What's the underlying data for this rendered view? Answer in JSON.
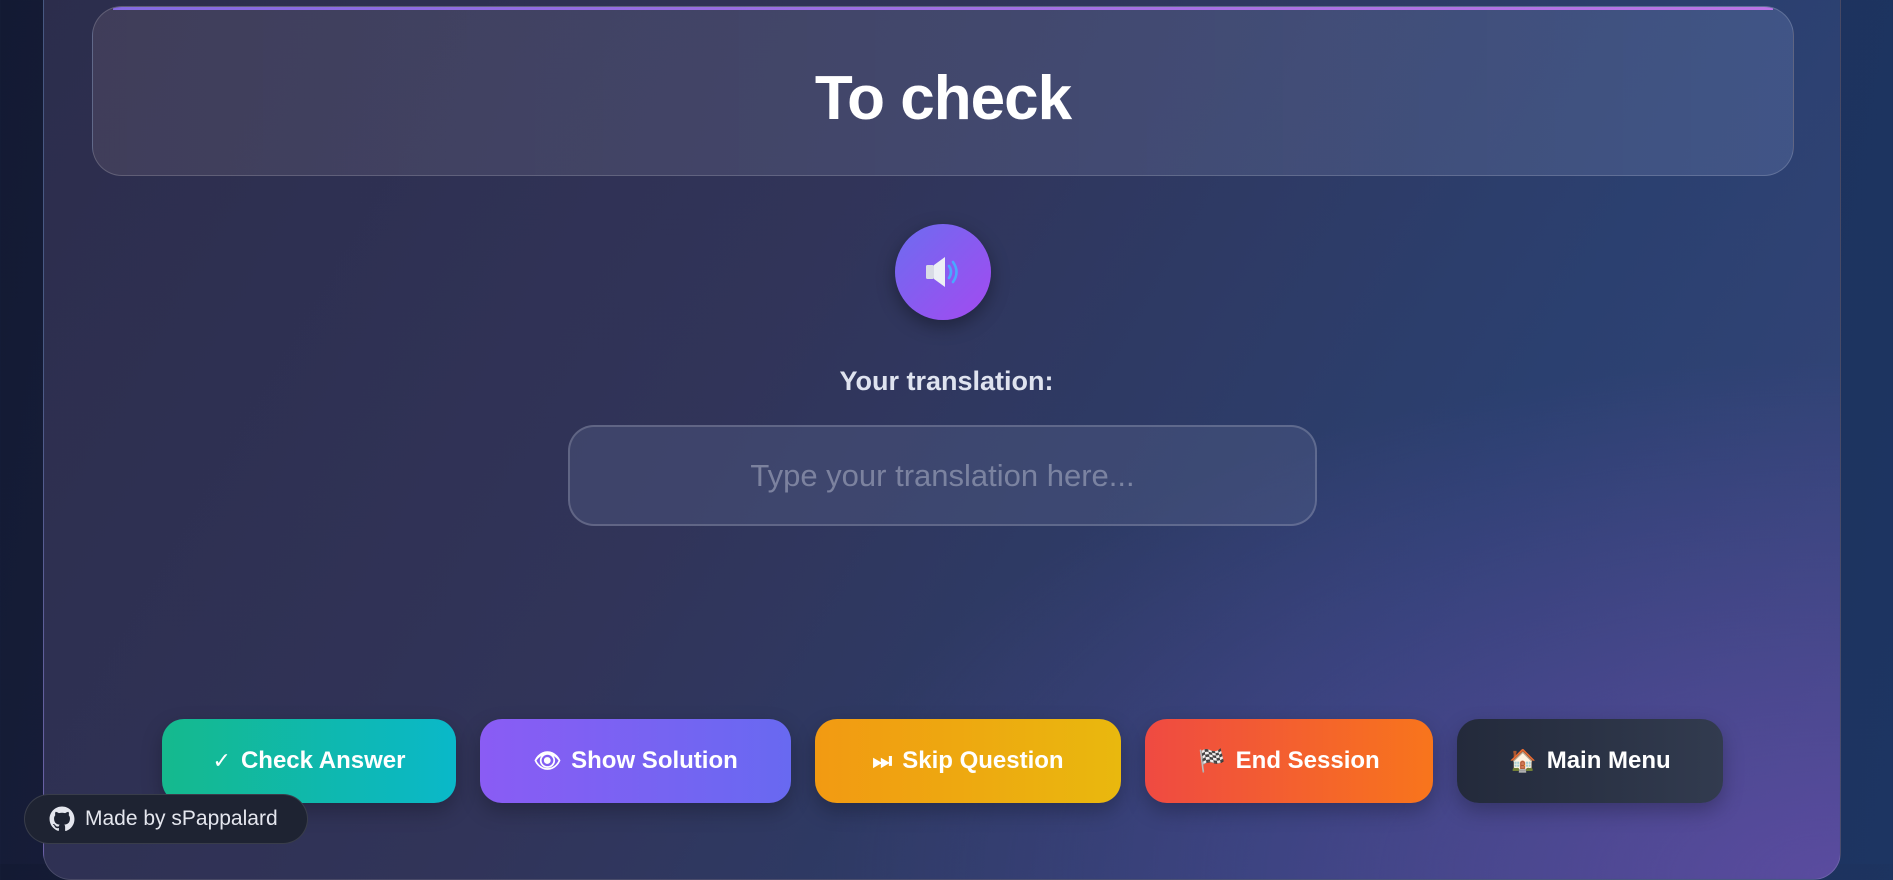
{
  "header": {
    "title": "To check"
  },
  "audio": {
    "icon": "speaker-icon"
  },
  "prompt": {
    "label": "Your translation:"
  },
  "answer": {
    "value": "",
    "placeholder": "Type your translation here..."
  },
  "actions": [
    {
      "icon": "checkmark-icon",
      "glyph": "✓",
      "label": "Check Answer",
      "colors": [
        "#15b98d",
        "#0ab8c9"
      ]
    },
    {
      "icon": "eye-icon",
      "glyph": "👁",
      "label": "Show Solution",
      "colors": [
        "#8a5cf4",
        "#6869f1"
      ]
    },
    {
      "icon": "skip-icon",
      "glyph": "⏭",
      "label": "Skip Question",
      "colors": [
        "#f29a12",
        "#e9b80e"
      ]
    },
    {
      "icon": "checkered-flag-icon",
      "glyph": "🏁",
      "label": "End Session",
      "colors": [
        "#ef4a42",
        "#f8751c"
      ]
    },
    {
      "icon": "house-icon",
      "glyph": "🏠",
      "label": "Main Menu",
      "colors": [
        "#232a3b",
        "#323b4f"
      ]
    }
  ],
  "footer": {
    "icon": "github-icon",
    "credit": "Made by sPappalard"
  }
}
